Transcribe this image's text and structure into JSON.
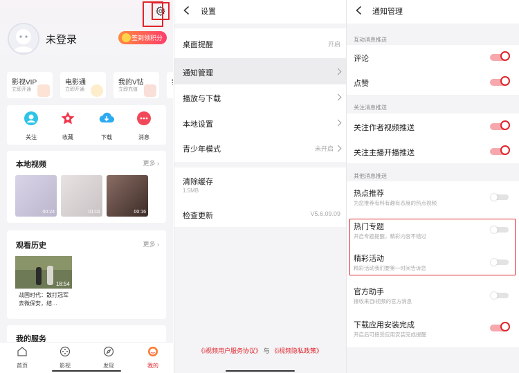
{
  "profile": {
    "login_text": "未登录",
    "signin_label": "签到领积分",
    "vip_cards": [
      {
        "title": "影视VIP",
        "sub": "立即开通"
      },
      {
        "title": "电影通",
        "sub": "立即开通"
      },
      {
        "title": "我的V钻",
        "sub": "立即充值"
      },
      {
        "title": "我",
        "sub": ""
      }
    ],
    "favorites": [
      {
        "label": "关注",
        "icon": "person-icon"
      },
      {
        "label": "收藏",
        "icon": "star-icon"
      },
      {
        "label": "下载",
        "icon": "download-icon"
      },
      {
        "label": "消息",
        "icon": "message-icon"
      }
    ],
    "local_video": {
      "title": "本地视频",
      "more": "更多",
      "thumbs": [
        {
          "duration": "00:24"
        },
        {
          "duration": "01:01"
        },
        {
          "duration": "00:16"
        }
      ]
    },
    "history": {
      "title": "观看历史",
      "more": "更多",
      "item": {
        "duration": "18:54",
        "caption": "战国时代：散打冠军去微保安，结…"
      }
    },
    "services_title": "我的服务",
    "tabs": [
      {
        "label": "首页",
        "icon": "home-icon"
      },
      {
        "label": "影视",
        "icon": "film-icon"
      },
      {
        "label": "发现",
        "icon": "compass-icon"
      },
      {
        "label": "我的",
        "icon": "me-icon"
      }
    ]
  },
  "settings": {
    "title": "设置",
    "desktop_reminder": {
      "label": "桌面提醒",
      "value": "开启"
    },
    "notify_manage": "通知管理",
    "play_download": "播放与下载",
    "local_settings": "本地设置",
    "youth_mode": {
      "label": "青少年模式",
      "value": "未开启"
    },
    "clear_cache": {
      "label": "清除缓存",
      "size": "1.5MB"
    },
    "check_update": {
      "label": "检查更新",
      "version": "V5.6.09.09"
    },
    "policy": {
      "agreement": "《i视频用户服务协议》",
      "and": "与",
      "privacy": "《i视频隐私政策》"
    }
  },
  "notifications": {
    "title": "通知管理",
    "groups": [
      {
        "head": "互动消息推送"
      },
      {
        "head": "关注消息推送"
      },
      {
        "head": "其他消息推送"
      }
    ],
    "items": {
      "comment": {
        "label": "评论",
        "on": true
      },
      "like": {
        "label": "点赞",
        "on": true
      },
      "follow_author": {
        "label": "关注作者视频推送",
        "on": true
      },
      "follow_live": {
        "label": "关注主播开播推送",
        "on": true
      },
      "hot_recommend": {
        "label": "热点推荐",
        "sub": "为您推荐有料有趣有态度的热点视频",
        "on": false
      },
      "hot_topic": {
        "label": "热门专题",
        "sub": "开启专题提醒，精彩内容不错过",
        "on": false
      },
      "events": {
        "label": "精彩活动",
        "sub": "精彩活动我们要第一时间告诉您",
        "on": false
      },
      "assistant": {
        "label": "官方助手",
        "sub": "接收来自i视频的官方消息",
        "on": false
      },
      "install_done": {
        "label": "下载应用安装完成",
        "sub": "开启后可接受应用安装完成提醒",
        "on": true
      }
    }
  },
  "colors": {
    "accent": "#e0242b",
    "toggle_track_on": "#f6a8ad"
  }
}
